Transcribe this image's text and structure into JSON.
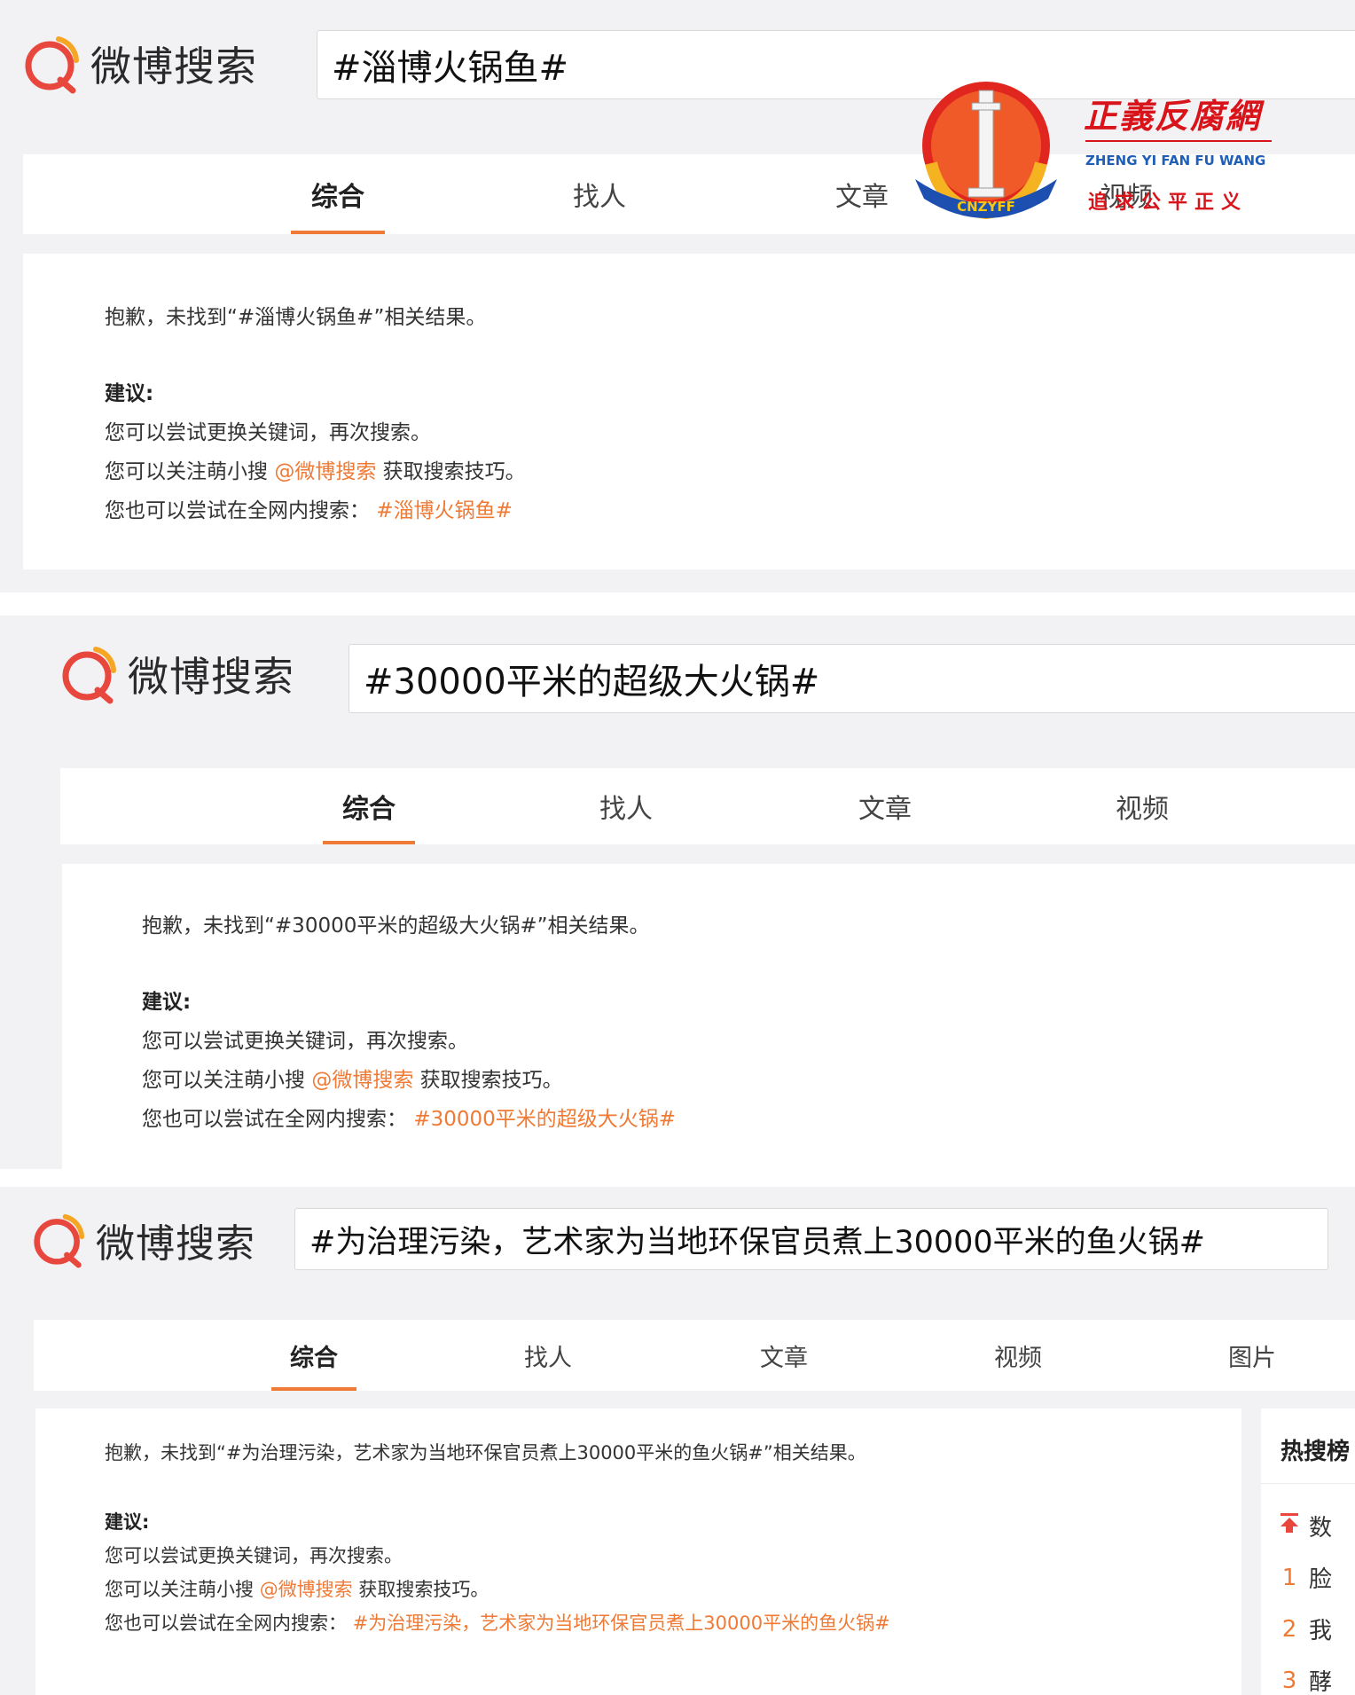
{
  "logo_text": "微博搜索",
  "tabs_common": {
    "comprehensive": "综合",
    "people": "找人",
    "articles": "文章",
    "video": "视频",
    "pictures": "图片"
  },
  "screens": [
    {
      "query": "#淄博火锅鱼#",
      "sorry": "抱歉，未找到“#淄博火锅鱼#”相关结果。",
      "suggest_title": "建议:",
      "tip1": "您可以尝试更换关键词，再次搜索。",
      "tip2_prefix": "您可以关注萌小搜 ",
      "tip2_link": "@微博搜索",
      "tip2_suffix": " 获取搜索技巧。",
      "tip3_prefix": "您也可以尝试在全网内搜索：",
      "tip3_link": "#淄博火锅鱼#"
    },
    {
      "query": "#30000平米的超级大火锅#",
      "sorry": "抱歉，未找到“#30000平米的超级大火锅#”相关结果。",
      "suggest_title": "建议:",
      "tip1": "您可以尝试更换关键词，再次搜索。",
      "tip2_prefix": "您可以关注萌小搜 ",
      "tip2_link": "@微博搜索",
      "tip2_suffix": " 获取搜索技巧。",
      "tip3_prefix": "您也可以尝试在全网内搜索：",
      "tip3_link": "#30000平米的超级大火锅#"
    },
    {
      "query": "#为治理污染，艺术家为当地环保官员煮上30000平米的鱼火锅#",
      "sorry": "抱歉，未找到“#为治理污染，艺术家为当地环保官员煮上30000平米的鱼火锅#”相关结果。",
      "suggest_title": "建议:",
      "tip1": "您可以尝试更换关键词，再次搜索。",
      "tip2_prefix": "您可以关注萌小搜 ",
      "tip2_link": "@微博搜索",
      "tip2_suffix": " 获取搜索技巧。",
      "tip3_prefix": "您也可以尝试在全网内搜索：",
      "tip3_link": "#为治理污染，艺术家为当地环保官员煮上30000平米的鱼火锅#"
    }
  ],
  "hot_search": {
    "title": "热搜榜",
    "items": [
      {
        "rank": "",
        "text": "数"
      },
      {
        "rank": "1",
        "text": "脸"
      },
      {
        "rank": "2",
        "text": "我"
      },
      {
        "rank": "3",
        "text": "酵"
      }
    ]
  },
  "watermark": {
    "name_cn": "正義反腐網",
    "name_en": "ZHENG YI FAN FU WANG",
    "motto": "追求公平正义",
    "badge_text": "CNZYFF"
  },
  "colors": {
    "accent": "#ef7a35",
    "logo_red": "#e8473d",
    "logo_orange": "#f5a623",
    "background": "#f2f2f5"
  }
}
